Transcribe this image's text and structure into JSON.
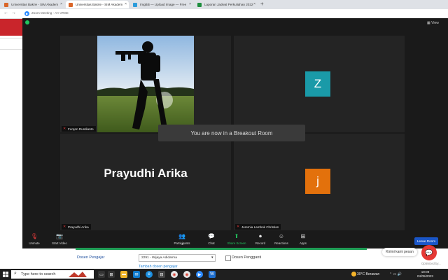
{
  "browser": {
    "tabs": [
      {
        "label": "Universitas Bakrie - SIM Akadem",
        "color": "#d9662a"
      },
      {
        "label": "Universitas Bakrie - SIM Akadem",
        "color": "#d9662a"
      },
      {
        "label": "ImgBB — Upload Image — Free",
        "color": "#2d9cdb"
      },
      {
        "label": "Laporan Jadwal Perkuliahan 2022",
        "color": "#1e8e3e"
      }
    ],
    "new_tab_icon": "plus-icon"
  },
  "zoom": {
    "title": "Zoom Meeting - AA VRSE",
    "view_label": "View",
    "participants": [
      {
        "name": "Furqon Rusdianto",
        "tile": "photo"
      },
      {
        "name": "",
        "tile": "avatar",
        "initial": "Z",
        "color": "#1a9aa8"
      },
      {
        "name": "Prayudhi Arika",
        "tile": "name",
        "big_name": "Prayudhi Arika"
      },
      {
        "name": "Jeremia Lambok Christian",
        "tile": "avatar",
        "initial": "j",
        "color": "#e3710c"
      }
    ],
    "breakout_message": "You are now in a Breakout Room",
    "controls": {
      "unmute": "Unmute",
      "start_video": "Start Video",
      "participants": "Participants",
      "participants_count": "4",
      "chat": "Chat",
      "share_screen": "Share Screen",
      "record": "Record",
      "reactions": "Reactions",
      "apps": "Apps",
      "leave": "Leave Room"
    }
  },
  "page": {
    "dosen_label": "Dosen Pengajar",
    "dosen_value": "2291 - Wijaya Adidarma",
    "pengganti_label": "Dosen Pengganti",
    "tambah_link": "Tambah dosen pengajar",
    "chat_pill": "Kirimi kami pesan",
    "optimize": "Optimized by..."
  },
  "taskbar": {
    "search_placeholder": "Type here to search",
    "weather": "30°C  Berawan",
    "time": "19:09",
    "date": "04/05/2023"
  }
}
